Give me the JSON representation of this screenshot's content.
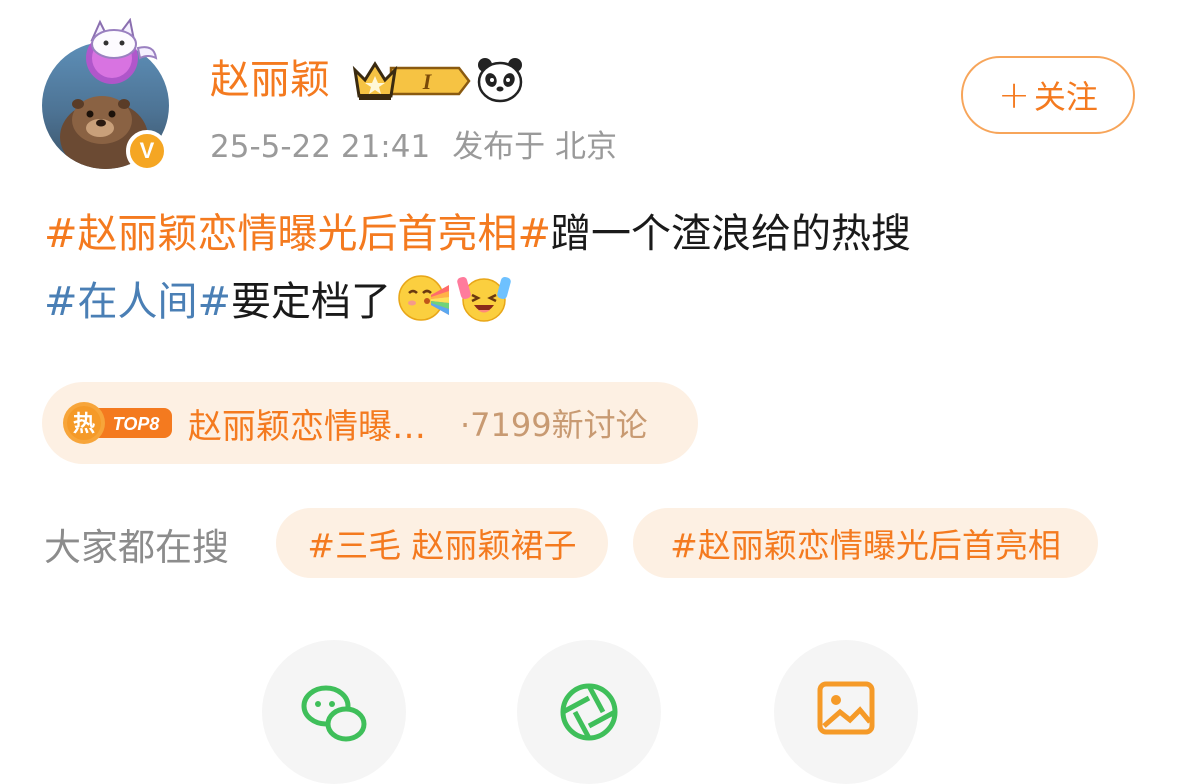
{
  "post": {
    "author": {
      "name": "赵丽颖",
      "vip_level": "I",
      "verified_mark": "V"
    },
    "meta": {
      "date": "25-5-22 21:41",
      "location": "发布于 北京"
    },
    "follow_label": "关注",
    "text": {
      "hashtag1": "#赵丽颖恋情曝光后首亮相#",
      "rest1": "蹭一个渣浪给的热搜",
      "hashtag2": "#在人间#",
      "rest2": "要定档了"
    }
  },
  "hot_topic": {
    "hot_char": "热",
    "rank": "TOP8",
    "title": "赵丽颖恋情曝…",
    "stats": "·7199新讨论"
  },
  "searching": {
    "label": "大家都在搜",
    "chips": [
      "#三毛 赵丽颖裙子",
      "#赵丽颖恋情曝光后首亮相"
    ]
  },
  "share": {
    "icons": [
      "wechat-icon",
      "moments-icon",
      "image-icon"
    ]
  },
  "colors": {
    "accent": "#f47a1f",
    "hashtag_blue": "#4a7fb5",
    "chip_bg": "#fdf0e3",
    "meta_gray": "#9a9a9a"
  }
}
